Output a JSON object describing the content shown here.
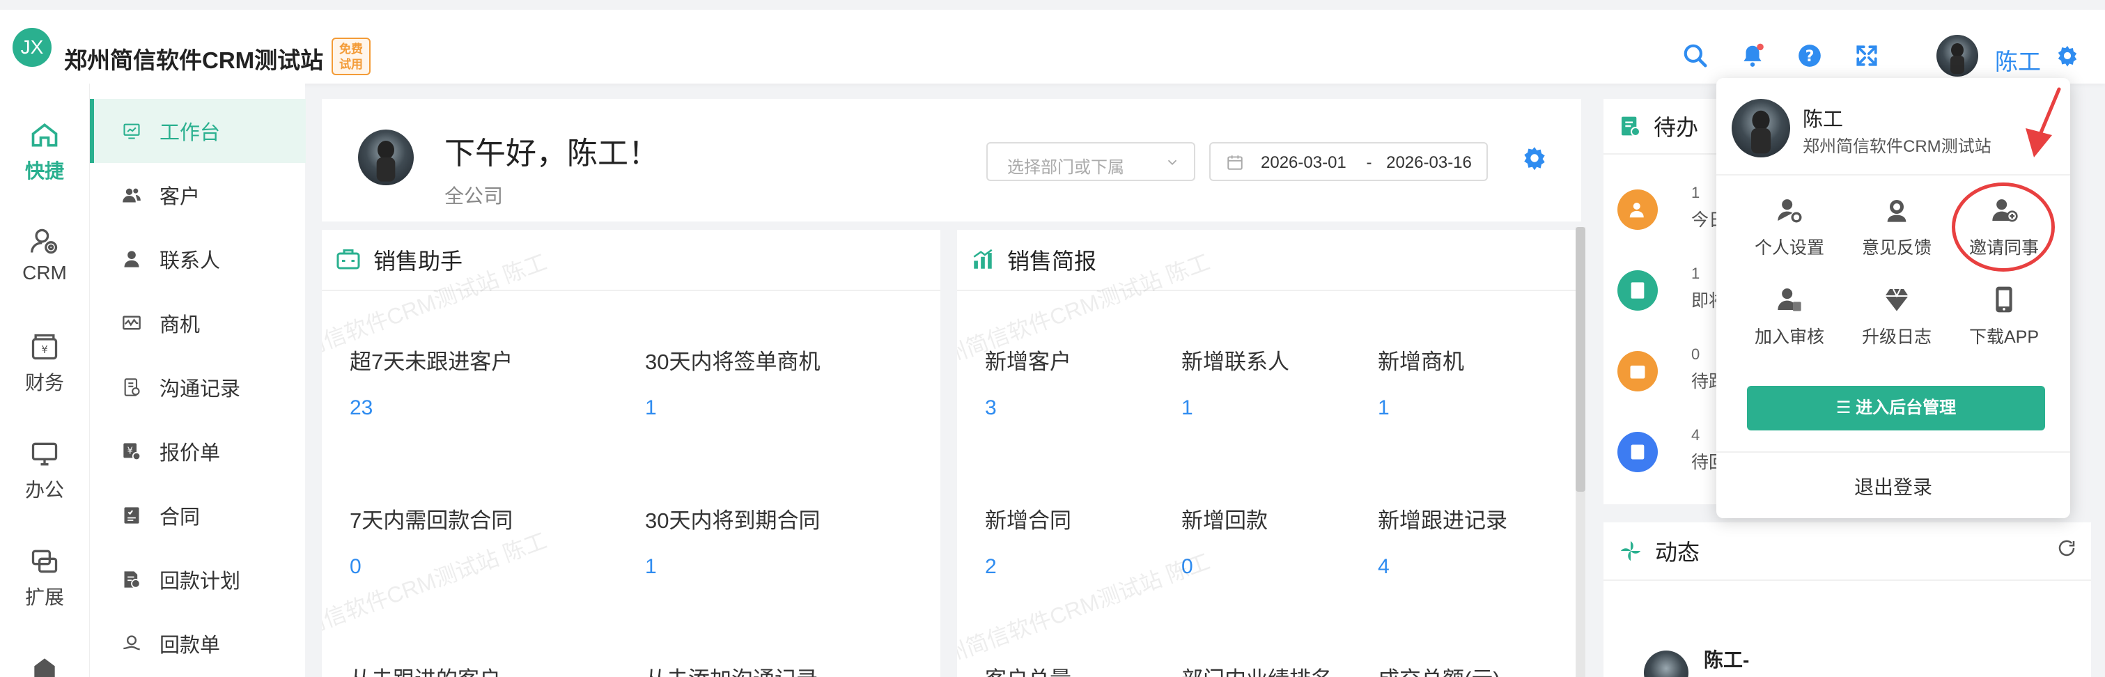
{
  "header": {
    "logo_text": "JX",
    "brand": "郑州简信软件CRM测试站",
    "badge_line1": "免费",
    "badge_line2": "试用",
    "user_name": "陈工",
    "accent": "#2ab08f",
    "link_color": "#2f8cf0"
  },
  "rail": [
    {
      "label": "快捷",
      "icon": "home-icon"
    },
    {
      "label": "CRM",
      "icon": "crm-user-icon"
    },
    {
      "label": "财务",
      "icon": "wallet-icon"
    },
    {
      "label": "办公",
      "icon": "monitor-icon"
    },
    {
      "label": "扩展",
      "icon": "extension-icon"
    }
  ],
  "submenu": [
    {
      "label": "工作台"
    },
    {
      "label": "客户"
    },
    {
      "label": "联系人"
    },
    {
      "label": "商机"
    },
    {
      "label": "沟通记录"
    },
    {
      "label": "报价单"
    },
    {
      "label": "合同"
    },
    {
      "label": "回款计划"
    },
    {
      "label": "回款单"
    }
  ],
  "greeting": {
    "title": "下午好，陈工！",
    "scope": "全公司",
    "dept_placeholder": "选择部门或下属",
    "date_start": "2026-03-01",
    "date_sep": "-",
    "date_end": "2026-03-16"
  },
  "sales_assistant": {
    "title": "销售助手",
    "stats": [
      {
        "label": "超7天未跟进客户",
        "value": "23"
      },
      {
        "label": "30天内将签单商机",
        "value": "1"
      },
      {
        "label": "7天内需回款合同",
        "value": "0"
      },
      {
        "label": "30天内将到期合同",
        "value": "1"
      },
      {
        "label": "从未跟进的客户",
        "value": ""
      },
      {
        "label": "从未添加沟通记录",
        "value": ""
      }
    ]
  },
  "sales_brief": {
    "title": "销售简报",
    "stats": [
      {
        "label": "新增客户",
        "value": "3"
      },
      {
        "label": "新增联系人",
        "value": "1"
      },
      {
        "label": "新增商机",
        "value": "1"
      },
      {
        "label": "新增合同",
        "value": "2"
      },
      {
        "label": "新增回款",
        "value": "0"
      },
      {
        "label": "新增跟进记录",
        "value": "4"
      },
      {
        "label": "客户总量",
        "value": ""
      },
      {
        "label": "部门内业绩排名",
        "value": ""
      },
      {
        "label": "成交总额(元)",
        "value": ""
      }
    ]
  },
  "todo": {
    "title": "待办",
    "items": [
      {
        "count": "1",
        "text": "今日需",
        "color": "#f39b37"
      },
      {
        "count": "1",
        "text": "即将到",
        "color": "#2ab08f"
      },
      {
        "count": "0",
        "text": "待跟进",
        "color": "#f39b37"
      },
      {
        "count": "4",
        "text": "待回款",
        "color": "#3d7cf2"
      }
    ]
  },
  "dynamics": {
    "title": "动态",
    "first_user": "陈工-"
  },
  "user_menu": {
    "name": "陈工",
    "org": "郑州简信软件CRM测试站",
    "actions": [
      {
        "label": "个人设置",
        "icon": "user-settings-icon"
      },
      {
        "label": "意见反馈",
        "icon": "feedback-icon"
      },
      {
        "label": "邀请同事",
        "icon": "invite-user-icon"
      },
      {
        "label": "加入审核",
        "icon": "join-review-icon"
      },
      {
        "label": "升级日志",
        "icon": "diamond-icon"
      },
      {
        "label": "下载APP",
        "icon": "phone-icon"
      }
    ],
    "admin_button": "☰ 进入后台管理",
    "logout": "退出登录"
  },
  "watermark": "郑州简信软件CRM测试站 陈工"
}
